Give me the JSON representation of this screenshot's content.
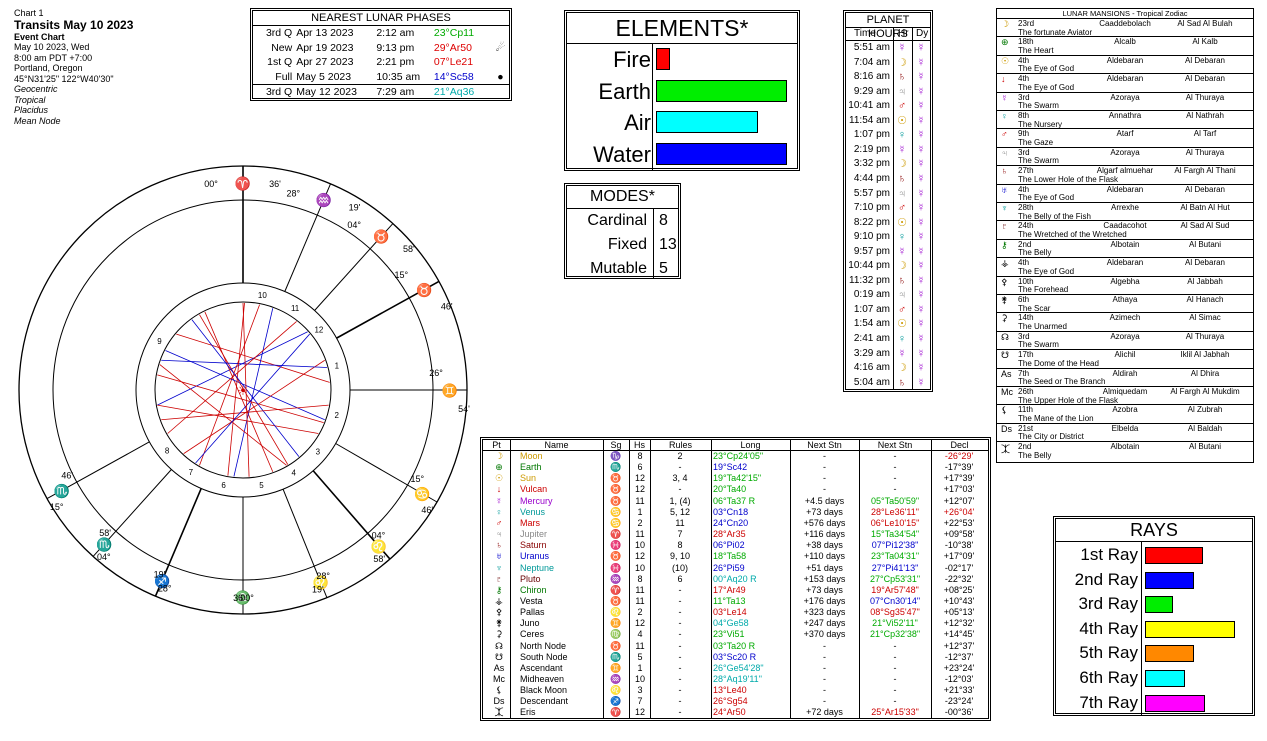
{
  "header": {
    "chart_num": "Chart 1",
    "title": "Transits May 10 2023",
    "subtitle": "Event Chart",
    "date": "May 10 2023, Wed",
    "time": "8:00 am  PDT +7:00",
    "place": "Portland, Oregon",
    "coords": "45°N31'25\"  122°W40'30\"",
    "opts": [
      "Geocentric",
      "Tropical",
      "Placidus",
      "Mean Node"
    ]
  },
  "lunar": {
    "title": "NEAREST LUNAR PHASES",
    "rows": [
      {
        "phase": "3rd Q",
        "date": "Apr 13 2023",
        "time": "2:12 am",
        "pos": "23°Cp11",
        "color": "#00aa00",
        "mark": ""
      },
      {
        "phase": "New",
        "date": "Apr 19 2023",
        "time": "9:13 pm",
        "pos": "29°Ar50",
        "color": "#dd0000",
        "mark": "☄"
      },
      {
        "phase": "1st Q",
        "date": "Apr 27 2023",
        "time": "2:21 pm",
        "pos": "07°Le21",
        "color": "#dd0000",
        "mark": ""
      },
      {
        "phase": "Full",
        "date": "May 5 2023",
        "time": "10:35 am",
        "pos": "14°Sc58",
        "color": "#0000cc",
        "mark": "●"
      },
      {
        "phase": "3rd Q",
        "date": "May 12 2023",
        "time": "7:29 am",
        "pos": "21°Aq36",
        "color": "#00aaaa",
        "mark": ""
      }
    ]
  },
  "elements": {
    "title": "ELEMENTS*",
    "rows": [
      {
        "label": "Fire",
        "frac": 0.11,
        "color": "#ff0000"
      },
      {
        "label": "Earth",
        "frac": 1.0,
        "color": "#00ee00"
      },
      {
        "label": "Air",
        "frac": 0.78,
        "color": "#00ffff"
      },
      {
        "label": "Water",
        "frac": 1.0,
        "color": "#0000ff"
      }
    ]
  },
  "modes": {
    "title": "MODES*",
    "rows": [
      {
        "label": "Cardinal",
        "value": "8"
      },
      {
        "label": "Fixed",
        "value": "13"
      },
      {
        "label": "Mutable",
        "value": "5"
      }
    ]
  },
  "planet_hours": {
    "title": "PLANET HOURS",
    "headers": [
      "Time",
      "Hr",
      "Dy"
    ],
    "rows": [
      {
        "t": "5:51 am",
        "hr": "☿",
        "hc": "#9900cc"
      },
      {
        "t": "7:04 am",
        "hr": "☽",
        "hc": "#cc9900"
      },
      {
        "t": "8:16 am",
        "hr": "♄",
        "hc": "#880000"
      },
      {
        "t": "9:29 am",
        "hr": "♃",
        "hc": "#888888"
      },
      {
        "t": "10:41 am",
        "hr": "♂",
        "hc": "#cc0000"
      },
      {
        "t": "11:54 am",
        "hr": "☉",
        "hc": "#cc9900"
      },
      {
        "t": "1:07 pm",
        "hr": "♀",
        "hc": "#009999"
      },
      {
        "t": "2:19 pm",
        "hr": "☿",
        "hc": "#9900cc"
      },
      {
        "t": "3:32 pm",
        "hr": "☽",
        "hc": "#cc9900"
      },
      {
        "t": "4:44 pm",
        "hr": "♄",
        "hc": "#880000"
      },
      {
        "t": "5:57 pm",
        "hr": "♃",
        "hc": "#888888"
      },
      {
        "t": "7:10 pm",
        "hr": "♂",
        "hc": "#cc0000"
      },
      {
        "t": "8:22 pm",
        "hr": "☉",
        "hc": "#cc9900"
      },
      {
        "t": "9:10 pm",
        "hr": "♀",
        "hc": "#009999"
      },
      {
        "t": "9:57 pm",
        "hr": "☿",
        "hc": "#9900cc"
      },
      {
        "t": "10:44 pm",
        "hr": "☽",
        "hc": "#cc9900"
      },
      {
        "t": "11:32 pm",
        "hr": "♄",
        "hc": "#880000"
      },
      {
        "t": "0:19 am",
        "hr": "♃",
        "hc": "#888888"
      },
      {
        "t": "1:07 am",
        "hr": "♂",
        "hc": "#cc0000"
      },
      {
        "t": "1:54 am",
        "hr": "☉",
        "hc": "#cc9900"
      },
      {
        "t": "2:41 am",
        "hr": "♀",
        "hc": "#009999"
      },
      {
        "t": "3:29 am",
        "hr": "☿",
        "hc": "#9900cc"
      },
      {
        "t": "4:16 am",
        "hr": "☽",
        "hc": "#cc9900"
      },
      {
        "t": "5:04 am",
        "hr": "♄",
        "hc": "#880000"
      }
    ],
    "day_glyph": "☿",
    "day_color": "#9900cc"
  },
  "mansions": {
    "title": "LUNAR MANSIONS - Tropical Zodiac",
    "rows": [
      {
        "ic": "☽",
        "ic_color": "#cc9900",
        "n": "23rd",
        "a": "Caaddebolach",
        "b": "Al Sad Al Bulah",
        "d": "The fortunate Aviator"
      },
      {
        "ic": "⊕",
        "ic_color": "#007700",
        "n": "18th",
        "a": "Alcalb",
        "b": "Al Kalb",
        "d": "The Heart"
      },
      {
        "ic": "☉",
        "ic_color": "#cc9900",
        "n": "4th",
        "a": "Aldebaran",
        "b": "Al Debaran",
        "d": "The Eye of God"
      },
      {
        "ic": "↓",
        "ic_color": "#cc0000",
        "n": "4th",
        "a": "Aldebaran",
        "b": "Al Debaran",
        "d": "The Eye of God"
      },
      {
        "ic": "☿",
        "ic_color": "#9900cc",
        "n": "3rd",
        "a": "Azoraya",
        "b": "Al Thuraya",
        "d": "The Swarm"
      },
      {
        "ic": "♀",
        "ic_color": "#009999",
        "n": "8th",
        "a": "Annathra",
        "b": "Al Nathrah",
        "d": "The Nursery"
      },
      {
        "ic": "♂",
        "ic_color": "#cc0000",
        "n": "9th",
        "a": "Atarf",
        "b": "Al Tarf",
        "d": "The Gaze"
      },
      {
        "ic": "♃",
        "ic_color": "#888888",
        "n": "3rd",
        "a": "Azoraya",
        "b": "Al Thuraya",
        "d": "The Swarm"
      },
      {
        "ic": "♄",
        "ic_color": "#880000",
        "n": "27th",
        "a": "Algarf almuehar",
        "b": "Al Fargh Al Thani",
        "d": "The Lower Hole of the Flask"
      },
      {
        "ic": "♅",
        "ic_color": "#0000cc",
        "n": "4th",
        "a": "Aldebaran",
        "b": "Al Debaran",
        "d": "The Eye of God"
      },
      {
        "ic": "♆",
        "ic_color": "#009999",
        "n": "28th",
        "a": "Arrexhe",
        "b": "Al Batn Al Hut",
        "d": "The Belly of the Fish"
      },
      {
        "ic": "♇",
        "ic_color": "#660000",
        "n": "24th",
        "a": "Caadacohot",
        "b": "Al Sad Al Sud",
        "d": "The Wretched of the Wretched"
      },
      {
        "ic": "⚷",
        "ic_color": "#007700",
        "n": "2nd",
        "a": "Albotain",
        "b": "Al Butani",
        "d": "The Belly"
      },
      {
        "ic": "⚶",
        "ic_color": "#000000",
        "n": "4th",
        "a": "Aldebaran",
        "b": "Al Debaran",
        "d": "The Eye of God"
      },
      {
        "ic": "⚴",
        "ic_color": "#000000",
        "n": "10th",
        "a": "Algebha",
        "b": "Al Jabbah",
        "d": "The Forehead"
      },
      {
        "ic": "⚵",
        "ic_color": "#000000",
        "n": "6th",
        "a": "Athaya",
        "b": "Al Hanach",
        "d": "The Scar"
      },
      {
        "ic": "⚳",
        "ic_color": "#000000",
        "n": "14th",
        "a": "Azimech",
        "b": "Al Simac",
        "d": "The Unarmed"
      },
      {
        "ic": "☊",
        "ic_color": "#000000",
        "n": "3rd",
        "a": "Azoraya",
        "b": "Al Thuraya",
        "d": "The Swarm"
      },
      {
        "ic": "☋",
        "ic_color": "#000000",
        "n": "17th",
        "a": "Alichil",
        "b": "Iklil Al Jabhah",
        "d": "The Dome of the Head"
      },
      {
        "ic": "As",
        "ic_color": "#000000",
        "n": "7th",
        "a": "Aldirah",
        "b": "Al Dhira",
        "d": "The Seed or The Branch"
      },
      {
        "ic": "Mc",
        "ic_color": "#000000",
        "n": "26th",
        "a": "Almiquedam",
        "b": "Al Fargh Al Mukdim",
        "d": "The Upper Hole of the Flask"
      },
      {
        "ic": "⚸",
        "ic_color": "#000000",
        "n": "11th",
        "a": "Azobra",
        "b": "Al Zubrah",
        "d": "The Mane of the Lion"
      },
      {
        "ic": "Ds",
        "ic_color": "#000000",
        "n": "21st",
        "a": "Elbelda",
        "b": "Al Baldah",
        "d": "The City or District"
      },
      {
        "ic": "⯰",
        "ic_color": "#000000",
        "n": "2nd",
        "a": "Albotain",
        "b": "Al Butani",
        "d": "The Belly"
      }
    ]
  },
  "rays": {
    "title": "RAYS",
    "rows": [
      {
        "label": "1st Ray",
        "frac": 0.55,
        "color": "#ff0000"
      },
      {
        "label": "2nd Ray",
        "frac": 0.47,
        "color": "#0000ff"
      },
      {
        "label": "3rd Ray",
        "frac": 0.27,
        "color": "#00ee00"
      },
      {
        "label": "4th Ray",
        "frac": 0.86,
        "color": "#ffff00"
      },
      {
        "label": "5th Ray",
        "frac": 0.47,
        "color": "#ff8800"
      },
      {
        "label": "6th Ray",
        "frac": 0.38,
        "color": "#00ffff"
      },
      {
        "label": "7th Ray",
        "frac": 0.57,
        "color": "#ff00ff"
      }
    ]
  },
  "ptable": {
    "headers": [
      "Pt",
      "Name",
      "Sg",
      "Hs",
      "Rules",
      "Long",
      "Next Stn",
      "Next Stn",
      "Decl"
    ],
    "rows": [
      {
        "g": "☽",
        "gc": "#cc9900",
        "name": "Moon",
        "nc": "#cc9900",
        "sg": "♑",
        "hs": "8",
        "rules": "2",
        "long": "23°Cp24'05\"",
        "lc": "#00aa00",
        "ns1": "-",
        "ns2": "-",
        "decl": "-26°29'",
        "dc": "#cc0000"
      },
      {
        "g": "⊕",
        "gc": "#007700",
        "name": "Earth",
        "nc": "#007700",
        "sg": "♏",
        "hs": "6",
        "rules": "-",
        "long": "19°Sc42",
        "lc": "#0000cc",
        "ns1": "-",
        "ns2": "-",
        "decl": "-17°39'",
        "dc": "#000000"
      },
      {
        "g": "☉",
        "gc": "#cc9900",
        "name": "Sun",
        "nc": "#cc9900",
        "sg": "♉",
        "hs": "12",
        "rules": "3, 4",
        "long": "19°Ta42'15\"",
        "lc": "#00aa00",
        "ns1": "-",
        "ns2": "-",
        "decl": "+17°39'",
        "dc": "#000000"
      },
      {
        "g": "↓",
        "gc": "#cc0000",
        "name": "Vulcan",
        "nc": "#cc0000",
        "sg": "♉",
        "hs": "12",
        "rules": "-",
        "long": "20°Ta40",
        "lc": "#00aa00",
        "ns1": "-",
        "ns2": "-",
        "decl": "+17°03'",
        "dc": "#000000"
      },
      {
        "g": "☿",
        "gc": "#9900cc",
        "name": "Mercury",
        "nc": "#9900cc",
        "sg": "♉",
        "hs": "11",
        "rules": "1, (4)",
        "long": "06°Ta37 R",
        "lc": "#00aa00",
        "ns1": "+4.5 days",
        "ns2": "05°Ta50'59\"",
        "n2c": "#00aa00",
        "decl": "+12°07'",
        "dc": "#000000"
      },
      {
        "g": "♀",
        "gc": "#009999",
        "name": "Venus",
        "nc": "#009999",
        "sg": "♋",
        "hs": "1",
        "rules": "5, 12",
        "long": "03°Cn18",
        "lc": "#0000cc",
        "ns1": "+73 days",
        "ns2": "28°Le36'11\"",
        "n2c": "#cc0000",
        "decl": "+26°04'",
        "dc": "#cc0000"
      },
      {
        "g": "♂",
        "gc": "#cc0000",
        "name": "Mars",
        "nc": "#cc0000",
        "sg": "♋",
        "hs": "2",
        "rules": "11",
        "long": "24°Cn20",
        "lc": "#0000cc",
        "ns1": "+576 days",
        "ns2": "06°Le10'15\"",
        "n2c": "#cc0000",
        "decl": "+22°53'",
        "dc": "#000000"
      },
      {
        "g": "♃",
        "gc": "#888888",
        "name": "Jupiter",
        "nc": "#888888",
        "sg": "♈",
        "hs": "11",
        "rules": "7",
        "long": "28°Ar35",
        "lc": "#cc0000",
        "ns1": "+116 days",
        "ns2": "15°Ta34'54\"",
        "n2c": "#00aa00",
        "decl": "+09°58'",
        "dc": "#000000"
      },
      {
        "g": "♄",
        "gc": "#880000",
        "name": "Saturn",
        "nc": "#880000",
        "sg": "♓",
        "hs": "10",
        "rules": "8",
        "long": "06°Pi02",
        "lc": "#0000cc",
        "ns1": "+38 days",
        "ns2": "07°Pi12'38\"",
        "n2c": "#0000cc",
        "decl": "-10°38'",
        "dc": "#000000"
      },
      {
        "g": "♅",
        "gc": "#0000cc",
        "name": "Uranus",
        "nc": "#0000cc",
        "sg": "♉",
        "hs": "12",
        "rules": "9, 10",
        "long": "18°Ta58",
        "lc": "#00aa00",
        "ns1": "+110 days",
        "ns2": "23°Ta04'31\"",
        "n2c": "#00aa00",
        "decl": "+17°09'",
        "dc": "#000000"
      },
      {
        "g": "♆",
        "gc": "#009999",
        "name": "Neptune",
        "nc": "#009999",
        "sg": "♓",
        "hs": "10",
        "rules": "(10)",
        "long": "26°Pi59",
        "lc": "#0000cc",
        "ns1": "+51 days",
        "ns2": "27°Pi41'13\"",
        "n2c": "#0000cc",
        "decl": "-02°17'",
        "dc": "#000000"
      },
      {
        "g": "♇",
        "gc": "#660000",
        "name": "Pluto",
        "nc": "#660000",
        "sg": "♒",
        "hs": "8",
        "rules": "6",
        "long": "00°Aq20 R",
        "lc": "#00aaaa",
        "ns1": "+153 days",
        "ns2": "27°Cp53'31\"",
        "n2c": "#00aa00",
        "decl": "-22°32'",
        "dc": "#000000"
      },
      {
        "g": "⚷",
        "gc": "#007700",
        "name": "Chiron",
        "nc": "#007700",
        "sg": "♈",
        "hs": "11",
        "rules": "-",
        "long": "17°Ar49",
        "lc": "#cc0000",
        "ns1": "+73 days",
        "ns2": "19°Ar57'48\"",
        "n2c": "#cc0000",
        "decl": "+08°25'",
        "dc": "#000000"
      },
      {
        "g": "⚶",
        "gc": "#000000",
        "name": "Vesta",
        "nc": "#000000",
        "sg": "♉",
        "hs": "11",
        "rules": "-",
        "long": "11°Ta13",
        "lc": "#00aa00",
        "ns1": "+176 days",
        "ns2": "07°Cn30'14\"",
        "n2c": "#0000cc",
        "decl": "+10°43'",
        "dc": "#000000"
      },
      {
        "g": "⚴",
        "gc": "#000000",
        "name": "Pallas",
        "nc": "#000000",
        "sg": "♌",
        "hs": "2",
        "rules": "-",
        "long": "03°Le14",
        "lc": "#cc0000",
        "ns1": "+323 days",
        "ns2": "08°Sg35'47\"",
        "n2c": "#cc0000",
        "decl": "+05°13'",
        "dc": "#000000"
      },
      {
        "g": "⚵",
        "gc": "#000000",
        "name": "Juno",
        "nc": "#000000",
        "sg": "♊",
        "hs": "12",
        "rules": "-",
        "long": "04°Ge58",
        "lc": "#00aaaa",
        "ns1": "+247 days",
        "ns2": "21°Vi52'11\"",
        "n2c": "#00aa00",
        "decl": "+12°32'",
        "dc": "#000000"
      },
      {
        "g": "⚳",
        "gc": "#000000",
        "name": "Ceres",
        "nc": "#000000",
        "sg": "♍",
        "hs": "4",
        "rules": "-",
        "long": "23°Vi51",
        "lc": "#00aa00",
        "ns1": "+370 days",
        "ns2": "21°Cp32'38\"",
        "n2c": "#00aa00",
        "decl": "+14°45'",
        "dc": "#000000"
      },
      {
        "g": "☊",
        "gc": "#000000",
        "name": "North Node",
        "nc": "#000000",
        "sg": "♉",
        "hs": "11",
        "rules": "-",
        "long": "03°Ta20 R",
        "lc": "#00aa00",
        "ns1": "-",
        "ns2": "-",
        "decl": "+12°37'",
        "dc": "#000000"
      },
      {
        "g": "☋",
        "gc": "#000000",
        "name": "South Node",
        "nc": "#000000",
        "sg": "♏",
        "hs": "5",
        "rules": "-",
        "long": "03°Sc20 R",
        "lc": "#0000cc",
        "ns1": "-",
        "ns2": "-",
        "decl": "-12°37'",
        "dc": "#000000"
      },
      {
        "g": "As",
        "gc": "#000000",
        "name": "Ascendant",
        "nc": "#000000",
        "sg": "♊",
        "hs": "1",
        "rules": "-",
        "long": "26°Ge54'28\"",
        "lc": "#00aaaa",
        "ns1": "-",
        "ns2": "-",
        "decl": "+23°24'",
        "dc": "#000000"
      },
      {
        "g": "Mc",
        "gc": "#000000",
        "name": "Midheaven",
        "nc": "#000000",
        "sg": "♒",
        "hs": "10",
        "rules": "-",
        "long": "28°Aq19'11\"",
        "lc": "#00aaaa",
        "ns1": "-",
        "ns2": "-",
        "decl": "-12°03'",
        "dc": "#000000"
      },
      {
        "g": "⚸",
        "gc": "#000000",
        "name": "Black Moon",
        "nc": "#000000",
        "sg": "♌",
        "hs": "3",
        "rules": "-",
        "long": "13°Le40",
        "lc": "#cc0000",
        "ns1": "-",
        "ns2": "-",
        "decl": "+21°33'",
        "dc": "#000000"
      },
      {
        "g": "Ds",
        "gc": "#000000",
        "name": "Descendant",
        "nc": "#000000",
        "sg": "♐",
        "hs": "7",
        "rules": "-",
        "long": "26°Sg54",
        "lc": "#cc0000",
        "ns1": "-",
        "ns2": "-",
        "decl": "-23°24'",
        "dc": "#000000"
      },
      {
        "g": "⯰",
        "gc": "#000000",
        "name": "Eris",
        "nc": "#000000",
        "sg": "♈",
        "hs": "12",
        "rules": "-",
        "long": "24°Ar50",
        "lc": "#cc0000",
        "ns1": "+72 days",
        "ns2": "25°Ar15'33\"",
        "n2c": "#cc0000",
        "decl": "-00°36'",
        "dc": "#000000"
      }
    ]
  },
  "wheel": {
    "cusps": [
      {
        "deg": "00°",
        "sign": "♈",
        "min": "36'",
        "sc": "#cc0000"
      },
      {
        "deg": "28°",
        "sign": "♒",
        "min": "19'",
        "sc": "#00aaaa"
      },
      {
        "deg": "04°",
        "sign": "♉",
        "min": "58'",
        "sc": "#00aa00"
      },
      {
        "deg": "15°",
        "sign": "♉",
        "min": "46'",
        "sc": "#00aa00"
      },
      {
        "deg": "26°",
        "sign": "♊",
        "min": "54'",
        "sc": "#00aaaa"
      },
      {
        "deg": "15°",
        "sign": "♋",
        "min": "46'",
        "sc": "#0000cc"
      },
      {
        "deg": "04°",
        "sign": "♌",
        "min": "58'",
        "sc": "#cc0000"
      },
      {
        "deg": "28°",
        "sign": "♌",
        "min": "19'",
        "sc": "#cc0000"
      },
      {
        "deg": "00°",
        "sign": "♎",
        "min": "36'",
        "sc": "#00aaaa"
      },
      {
        "deg": "28°",
        "sign": "♐",
        "min": "19'",
        "sc": "#cc0000"
      },
      {
        "deg": "04°",
        "sign": "♏",
        "min": "58'",
        "sc": "#0000cc"
      },
      {
        "deg": "15°",
        "sign": "♏",
        "min": "46'",
        "sc": "#0000cc"
      }
    ],
    "house_nums": [
      "10",
      "11",
      "12",
      "1",
      "2",
      "3",
      "4",
      "5",
      "6",
      "7",
      "8",
      "9"
    ],
    "center_glyph": "☀"
  }
}
